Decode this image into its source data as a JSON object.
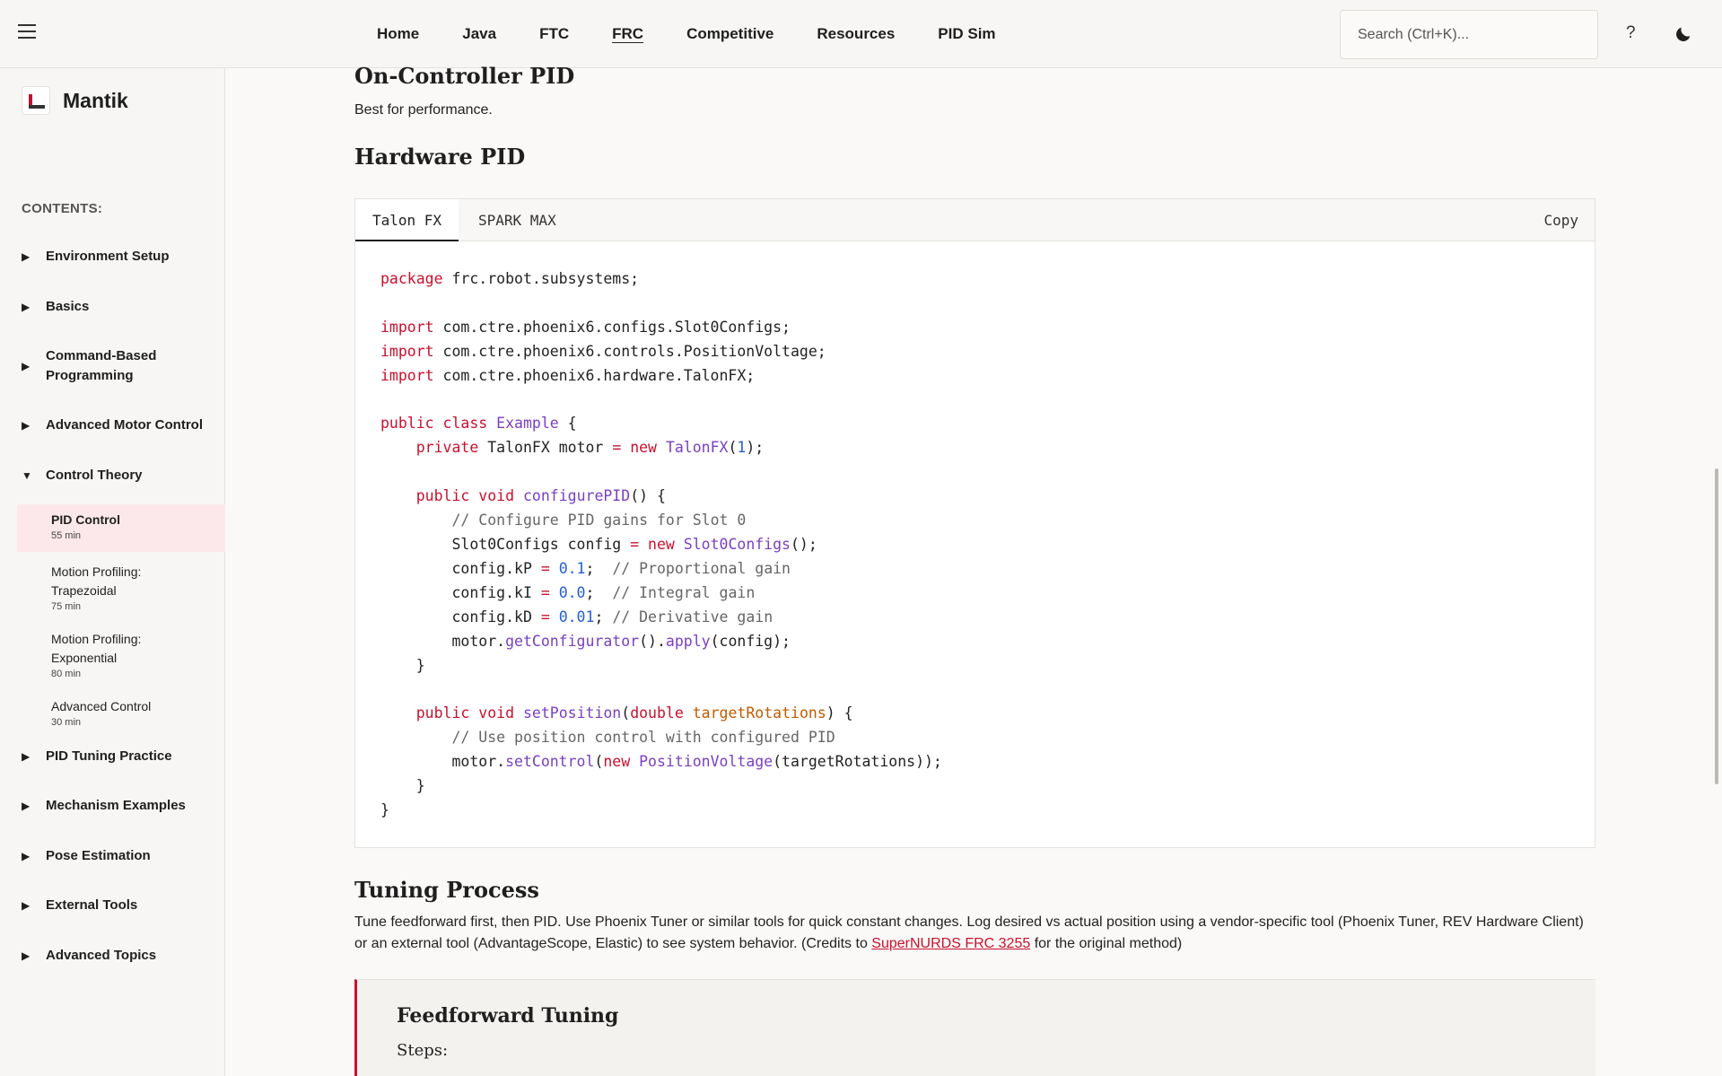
{
  "nav": {
    "items": [
      "Home",
      "Java",
      "FTC",
      "FRC",
      "Competitive",
      "Resources",
      "PID Sim"
    ],
    "active": "FRC",
    "search_placeholder": "Search (Ctrl+K)...",
    "help_label": "?"
  },
  "sidebar": {
    "brand": "Mantik",
    "contents_label": "CONTENTS:",
    "sections": [
      {
        "label": "Environment Setup",
        "arrow": "▶"
      },
      {
        "label": "Basics",
        "arrow": "▶"
      },
      {
        "label": "Command-Based Programming",
        "arrow": "▶"
      },
      {
        "label": "Advanced Motor Control",
        "arrow": "▶"
      },
      {
        "label": "Control Theory",
        "arrow": "▼"
      },
      {
        "label": "PID Tuning Practice",
        "arrow": "▶"
      },
      {
        "label": "Mechanism Examples",
        "arrow": "▶"
      },
      {
        "label": "Pose Estimation",
        "arrow": "▶"
      },
      {
        "label": "External Tools",
        "arrow": "▶"
      },
      {
        "label": "Advanced Topics",
        "arrow": "▶"
      }
    ],
    "subitems": [
      {
        "title": "PID Control",
        "time": "55 min",
        "active": true
      },
      {
        "title": "Motion Profiling: Trapezoidal",
        "time": "75 min"
      },
      {
        "title": "Motion Profiling: Exponential",
        "time": "80 min"
      },
      {
        "title": "Advanced Control",
        "time": "30 min"
      }
    ]
  },
  "main": {
    "on_controller_heading": "On-Controller PID",
    "on_controller_text": "Best for performance.",
    "hardware_heading": "Hardware PID",
    "code_tabs": [
      "Talon FX",
      "SPARK MAX"
    ],
    "copy_label": "Copy",
    "tuning_heading": "Tuning Process",
    "tuning_text_before": "Tune feedforward first, then PID. Use Phoenix Tuner or similar tools for quick constant changes. Log desired vs actual position using a vendor-specific tool (Phoenix Tuner, REV Hardware Client) or an external tool (AdvantageScope, Elastic) to see system behavior. (Credits to ",
    "tuning_link": "SuperNURDS FRC 3255",
    "tuning_text_after": " for the original method)",
    "callout_heading": "Feedforward Tuning",
    "callout_steps": "Steps:"
  },
  "colors": {
    "accent": "#c8102e",
    "active_bg": "#fce8ea",
    "keyword": "#c8102e",
    "type": "#7a3fc2",
    "number": "#1f5fd1"
  },
  "icons": [
    "hamburger-menu-icon",
    "help-icon",
    "moon-icon",
    "brand-logo-icon"
  ]
}
